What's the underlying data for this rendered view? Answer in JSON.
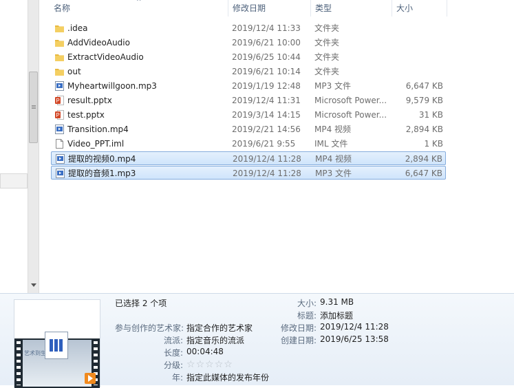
{
  "columns": {
    "name": "名称",
    "date": "修改日期",
    "type": "类型",
    "size": "大小"
  },
  "files": [
    {
      "name": ".idea",
      "date": "2019/12/4 11:33",
      "type": "文件夹",
      "size": "",
      "icon": "folder-icon",
      "selected": false
    },
    {
      "name": "AddVideoAudio",
      "date": "2019/6/21 10:00",
      "type": "文件夹",
      "size": "",
      "icon": "folder-icon",
      "selected": false
    },
    {
      "name": "ExtractVideoAudio",
      "date": "2019/6/25 10:44",
      "type": "文件夹",
      "size": "",
      "icon": "folder-icon",
      "selected": false
    },
    {
      "name": "out",
      "date": "2019/6/21 10:14",
      "type": "文件夹",
      "size": "",
      "icon": "folder-icon",
      "selected": false
    },
    {
      "name": "Myheartwillgoon.mp3",
      "date": "2019/1/19 12:48",
      "type": "MP3 文件",
      "size": "6,647 KB",
      "icon": "media-file-icon",
      "selected": false
    },
    {
      "name": "result.pptx",
      "date": "2019/12/4 11:31",
      "type": "Microsoft Power...",
      "size": "9,579 KB",
      "icon": "powerpoint-file-icon",
      "selected": false
    },
    {
      "name": "test.pptx",
      "date": "2019/3/14 14:15",
      "type": "Microsoft Power...",
      "size": "31 KB",
      "icon": "powerpoint-file-icon",
      "selected": false
    },
    {
      "name": "Transition.mp4",
      "date": "2019/2/21 14:56",
      "type": "MP4 视频",
      "size": "2,894 KB",
      "icon": "media-file-icon",
      "selected": false
    },
    {
      "name": "Video_PPT.iml",
      "date": "2019/6/21 9:55",
      "type": "IML 文件",
      "size": "1 KB",
      "icon": "blank-file-icon",
      "selected": false
    },
    {
      "name": "提取的视频0.mp4",
      "date": "2019/12/4 11:28",
      "type": "MP4 视频",
      "size": "2,894 KB",
      "icon": "media-file-icon",
      "selected": true
    },
    {
      "name": "提取的音频1.mp3",
      "date": "2019/12/4 11:28",
      "type": "MP3 文件",
      "size": "6,647 KB",
      "icon": "media-file-icon",
      "selected": true
    }
  ],
  "details": {
    "selection": "已选择 2 个项",
    "artist_label": "参与创作的艺术家:",
    "artist_value": "指定合作的艺术家",
    "genre_label": "流派:",
    "genre_value": "指定音乐的流派",
    "length_label": "长度:",
    "length_value": "00:04:48",
    "rating_label": "分级:",
    "rating_stars": 0,
    "year_label": "年:",
    "year_value": "指定此媒体的发布年份",
    "size_label": "大小:",
    "size_value": "9.31 MB",
    "title_label": "标题:",
    "title_value": "添加标题",
    "modified_label": "修改日期:",
    "modified_value": "2019/12/4 11:28",
    "created_label": "创建日期:",
    "created_value": "2019/6/25 13:58",
    "thumb_text": "艺术到生活"
  },
  "colors": {
    "selection_bg": "#cfe4fb",
    "selection_border": "#84acdd",
    "folder": "#e8b940",
    "powerpoint": "#d24726"
  }
}
